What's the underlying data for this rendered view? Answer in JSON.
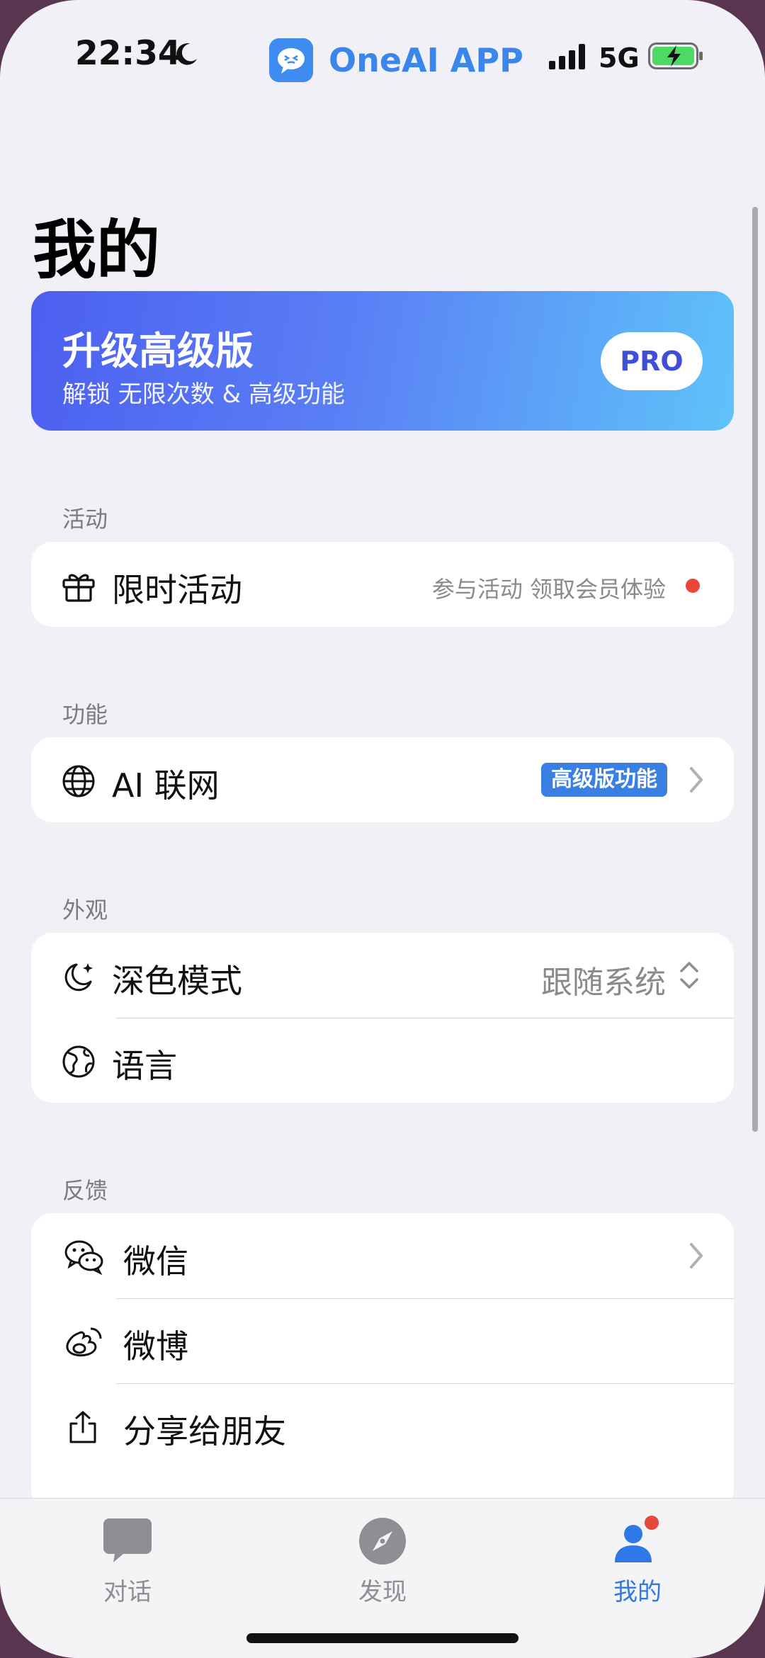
{
  "status_bar": {
    "time": "22:34",
    "app_name": "OneAI APP",
    "network": "5G"
  },
  "page": {
    "title": "我的"
  },
  "pro_banner": {
    "title": "升级高级版",
    "subtitle": "解锁 无限次数 & 高级功能",
    "button": "PRO",
    "gradient_start": "#4c5ff0",
    "gradient_end": "#5fc3f9"
  },
  "sections": {
    "activity": {
      "label": "活动",
      "items": [
        {
          "label": "限时活动",
          "hint": "参与活动 领取会员体验",
          "icon": "gift-icon"
        }
      ]
    },
    "features": {
      "label": "功能",
      "items": [
        {
          "label": "AI 联网",
          "badge": "高级版功能",
          "icon": "globe-icon"
        }
      ]
    },
    "appearance": {
      "label": "外观",
      "items": [
        {
          "label": "深色模式",
          "value": "跟随系统",
          "icon": "moon-stars-icon"
        },
        {
          "label": "语言",
          "icon": "language-globe-icon"
        }
      ]
    },
    "feedback": {
      "label": "反馈",
      "items": [
        {
          "label": "微信",
          "icon": "wechat-icon"
        },
        {
          "label": "微博",
          "icon": "weibo-icon"
        },
        {
          "label": "分享给朋友",
          "icon": "share-icon"
        }
      ]
    }
  },
  "tabbar": {
    "items": [
      {
        "label": "对话",
        "icon": "chat-bubble-icon",
        "active": false
      },
      {
        "label": "发现",
        "icon": "compass-icon",
        "active": false
      },
      {
        "label": "我的",
        "icon": "person-icon",
        "active": true
      }
    ]
  },
  "colors": {
    "accent": "#2f78ea",
    "notification": "#e7483b",
    "background": "#f1f0f6"
  }
}
